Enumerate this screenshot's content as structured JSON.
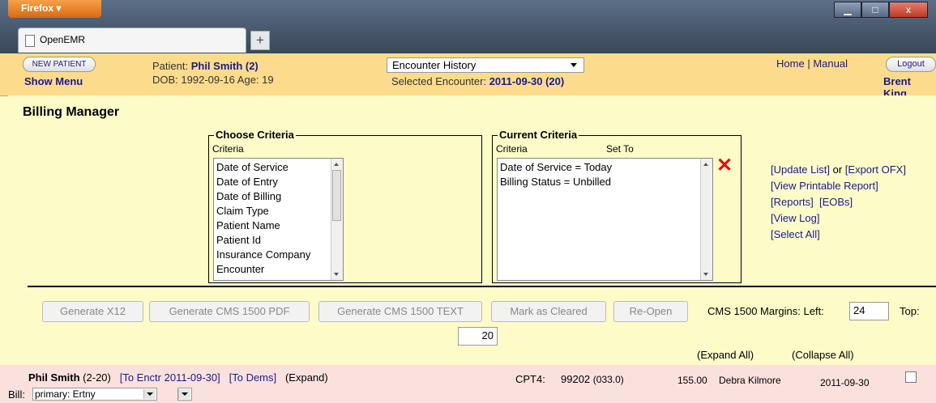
{
  "browser": {
    "menu_button": "Firefox ▾",
    "tab_title": "OpenEMR",
    "new_tab": "+",
    "win_min": "▁",
    "win_max": "□",
    "win_close": "x"
  },
  "nav": {
    "new_patient": "NEW PATIENT",
    "show_menu": "Show Menu",
    "patient_label": "Patient: ",
    "patient_name": "Phil Smith (2)",
    "dob_line": "DOB: 1992-09-16 Age: 19",
    "encounter_select": "Encounter History",
    "selected_enc_label": "Selected Encounter: ",
    "selected_enc_value": "2011-09-30 (20)",
    "home": "Home",
    "sep": "|",
    "manual": "Manual",
    "logout": "Logout",
    "user": "Brent King"
  },
  "page": {
    "title": "Billing Manager",
    "choose": {
      "legend": "Choose Criteria",
      "label": "Criteria",
      "items": [
        "Date of Service",
        "Date of Entry",
        "Date of Billing",
        "Claim Type",
        "Patient Name",
        "Patient Id",
        "Insurance Company",
        "Encounter"
      ]
    },
    "current": {
      "legend": "Current Criteria",
      "label_criteria": "Criteria",
      "label_setto": "Set To",
      "items": [
        "Date of Service = Today",
        "Billing Status = Unbilled"
      ],
      "remove_icon": "✕"
    },
    "links": {
      "update_list": "[Update List]",
      "or": " or ",
      "export_ofx": "[Export OFX]",
      "printable": "[View Printable Report]",
      "reports": "[Reports]",
      "eobs": "[EOBs]",
      "view_log": "[View Log]",
      "select_all": "[Select All]"
    },
    "buttons": {
      "x12": "Generate X12",
      "cms_pdf": "Generate CMS 1500 PDF",
      "cms_text": "Generate CMS 1500 TEXT",
      "mark": "Mark as Cleared",
      "reopen": "Re-Open"
    },
    "margins": {
      "label": "CMS 1500 Margins:  Left:",
      "left": "24",
      "top_label": "Top:",
      "top": "20"
    },
    "expand_all": "(Expand All)",
    "collapse_all": "(Collapse All)",
    "row": {
      "patient": "Phil Smith",
      "pid": " (2-20)",
      "to_enctr": "[To Enctr 2011-09-30]",
      "to_dems": "[To Dems]",
      "expand": "(Expand)",
      "cpt_label": "CPT4:",
      "cpt_code": "99202",
      "cpt_mod": "(033.0)",
      "amount": "155.00",
      "provider": "Debra Kilmore",
      "date": "2011-09-30",
      "bill_label": "Bill:",
      "bill_select": "primary: Ertny"
    }
  }
}
